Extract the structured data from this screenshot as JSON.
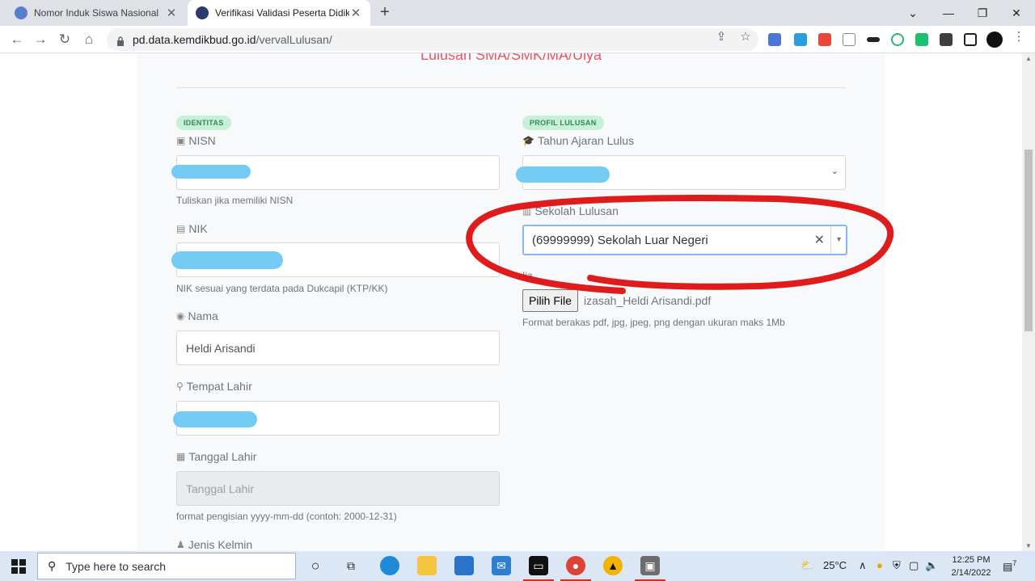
{
  "browser": {
    "tabs": [
      {
        "title": "Nomor Induk Siswa Nasional",
        "active": false
      },
      {
        "title": "Verifikasi Validasi Peserta Didik Lu",
        "active": true
      }
    ],
    "url_host": "pd.data.kemdikbud.go.id",
    "url_path": "/vervalLulusan/",
    "window_controls": {
      "minimize": "—",
      "restore": "❐",
      "close": "✕"
    }
  },
  "page": {
    "heading": "Lulusan SMA/SMK/MA/Ulya",
    "sections": {
      "identitas": "IDENTITAS",
      "profil": "PROFIL LULUSAN"
    },
    "fields": {
      "nisn": {
        "label": "NISN",
        "help": "Tuliskan jika memiliki NISN"
      },
      "nik": {
        "label": "NIK",
        "help": "NIK sesuai yang terdata pada Dukcapil (KTP/KK)"
      },
      "nama": {
        "label": "Nama",
        "value": "Heldi Arisandi"
      },
      "tempat_lahir": {
        "label": "Tempat Lahir"
      },
      "tanggal_lahir": {
        "label": "Tanggal Lahir",
        "placeholder": "Tanggal Lahir",
        "help": "format pengisian yyyy-mm-dd (contoh: 2000-12-31)"
      },
      "jenis_kelamin": {
        "label": "Jenis Kelmin"
      },
      "tahun_ajaran": {
        "label": "Tahun Ajaran Lulus"
      },
      "sekolah": {
        "label": "Sekolah Lulusan",
        "value": "(69999999) Sekolah Luar Negeri"
      },
      "ijazah": {
        "label_partial": "Ija",
        "button": "Pilih File",
        "filename": "izasah_Heldi Arisandi.pdf",
        "help": "Format berakas pdf, jpg, jpeg, png dengan ukuran maks 1Mb"
      }
    }
  },
  "taskbar": {
    "search_placeholder": "Type here to search",
    "weather": "25°C",
    "time": "12:25 PM",
    "date": "2/14/2022",
    "notifications": "7"
  },
  "colors": {
    "heading": "#e8556a",
    "badge_bg": "#c8f0d6",
    "badge_fg": "#2e8b57",
    "annotation": "#e01b1b",
    "redaction": "#74ccf4"
  }
}
